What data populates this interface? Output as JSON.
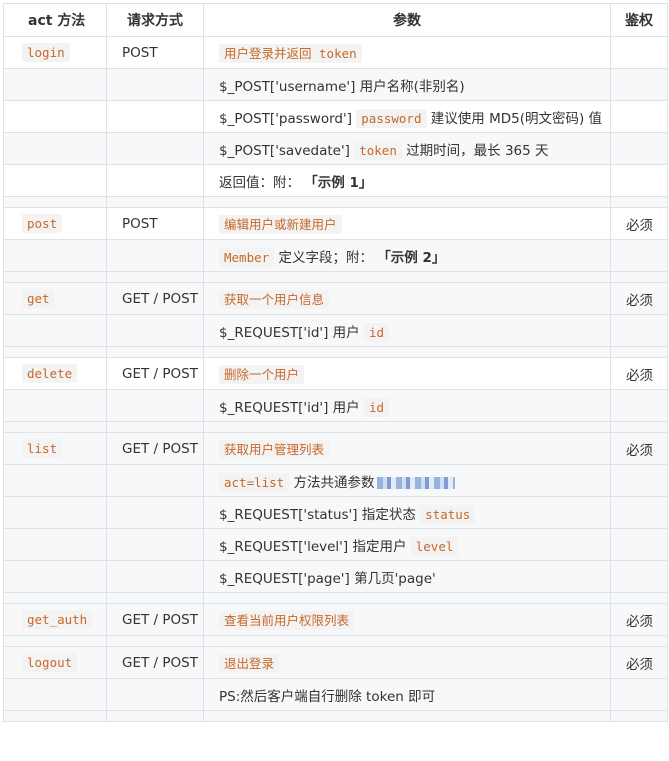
{
  "headers": [
    "act 方法",
    "请求方式",
    "参数",
    "鉴权"
  ],
  "rows": [
    {
      "act": "login",
      "method": "POST",
      "param": [
        "",
        "用户登录并返回 token",
        ""
      ],
      "auth": ""
    },
    {
      "act": "",
      "method": "",
      "param": [
        "$_POST['username'] 用户名称(非别名)",
        "",
        ""
      ],
      "auth": ""
    },
    {
      "act": "",
      "method": "",
      "param": [
        "$_POST['password']",
        "password",
        "建议使用 MD5(明文密码) 值"
      ],
      "auth": ""
    },
    {
      "act": "",
      "method": "",
      "param": [
        "$_POST['savedate']",
        "token",
        "过期时间，最长 365 天"
      ],
      "auth": ""
    },
    {
      "act": "",
      "method": "",
      "param": [
        "返回值：附：",
        "「示例 1」",
        ""
      ],
      "auth": ""
    },
    {
      "spacer": true
    },
    {
      "act": "post",
      "method": "POST",
      "param": [
        "",
        "编辑用户或新建用户",
        ""
      ],
      "auth": "必须"
    },
    {
      "act": "",
      "method": "",
      "param": [
        "",
        "Member",
        "定义字段；附："
      ],
      "extra": "「示例 2」",
      "auth": ""
    },
    {
      "spacer": true
    },
    {
      "act": "get",
      "method": "GET / POST",
      "param": [
        "",
        "获取一个用户信息",
        ""
      ],
      "auth": "必须"
    },
    {
      "act": "",
      "method": "",
      "param": [
        "$_REQUEST['id'] 用户",
        "id",
        ""
      ],
      "auth": ""
    },
    {
      "spacer": true
    },
    {
      "act": "delete",
      "method": "GET / POST",
      "param": [
        "",
        "删除一个用户",
        ""
      ],
      "auth": "必须"
    },
    {
      "act": "",
      "method": "",
      "param": [
        "$_REQUEST['id'] 用户",
        "id",
        ""
      ],
      "auth": ""
    },
    {
      "spacer": true
    },
    {
      "act": "list",
      "method": "GET / POST",
      "param": [
        "",
        "获取用户管理列表",
        ""
      ],
      "auth": "必须"
    },
    {
      "act": "",
      "method": "",
      "param": [
        "",
        "act=list",
        "方法共通参数"
      ],
      "auth": ""
    },
    {
      "act": "",
      "method": "",
      "param": [
        "$_REQUEST['status'] 指定状态",
        "status",
        ""
      ],
      "auth": ""
    },
    {
      "act": "",
      "method": "",
      "param": [
        "$_REQUEST['level'] 指定用户",
        "level",
        ""
      ],
      "auth": ""
    },
    {
      "act": "",
      "method": "",
      "param": [
        "$_REQUEST['page'] 第几页'page'",
        "",
        ""
      ],
      "auth": ""
    },
    {
      "spacer": true
    },
    {
      "act": "get_auth",
      "method": "GET / POST",
      "param": [
        "",
        "查看当前用户权限列表",
        ""
      ],
      "auth": "必须"
    },
    {
      "spacer": true
    },
    {
      "act": "logout",
      "method": "GET / POST",
      "param": [
        "",
        "退出登录",
        ""
      ],
      "auth": "必须"
    },
    {
      "act": "",
      "method": "",
      "param": [
        "PS:然后客户端自行删除 token 即可",
        "",
        ""
      ],
      "auth": ""
    },
    {
      "spacer": true
    }
  ]
}
